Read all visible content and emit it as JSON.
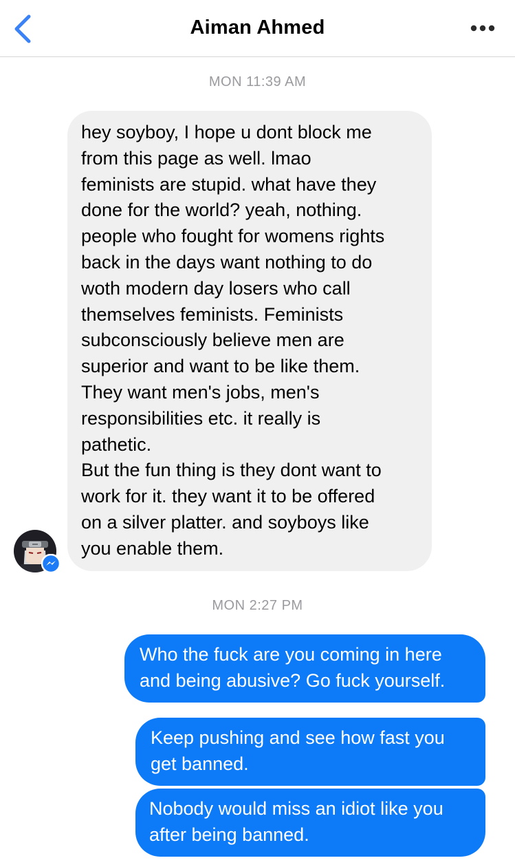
{
  "header": {
    "title": "Aiman Ahmed",
    "back_icon": "chevron-left-icon",
    "more_icon": "more-horizontal-icon"
  },
  "colors": {
    "accent": "#3b82f6",
    "outgoing_bubble": "#0d7bf7",
    "incoming_bubble": "#f0f0f0",
    "timestamp": "#9a9a9f"
  },
  "conversation": {
    "timestamp_1": "MON 11:39 AM",
    "incoming_1": "hey soyboy, I hope u dont block me\nfrom this page as well. lmao\nfeminists are stupid. what have they\ndone for the world? yeah, nothing.\npeople who fought for womens rights\nback in the days want nothing to do\nwoth modern day losers who call\nthemselves feminists. Feminists\nsubconsciously believe men are\nsuperior and want to be like them.\nThey want men's jobs, men's\nresponsibilities etc. it really is\npathetic.\nBut the fun thing is they dont want to\nwork for it. they want it to be offered\non a silver platter. and soyboys like\nyou enable them.",
    "timestamp_2": "MON 2:27 PM",
    "outgoing_1": "Who the fuck are you coming in here\nand being abusive? Go fuck yourself.",
    "outgoing_2": "Keep pushing and see how fast you\nget banned.",
    "outgoing_3": "Nobody would miss an idiot like you\nafter being banned."
  }
}
